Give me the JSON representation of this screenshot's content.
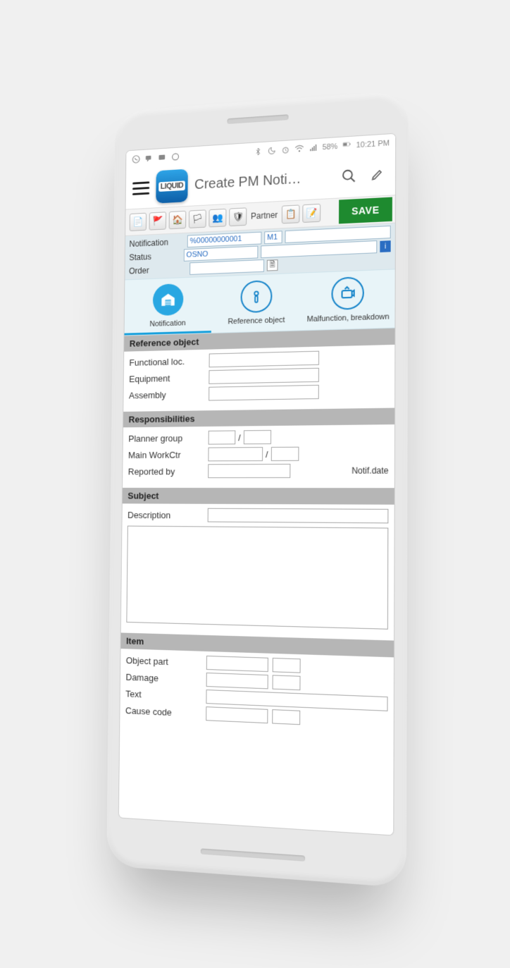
{
  "statusbar": {
    "battery": "58%",
    "time": "10:21 PM"
  },
  "app": {
    "logo": "LIQUID",
    "title": "Create PM Noti…"
  },
  "sapbar": {
    "partner_label": "Partner",
    "save_label": "SAVE"
  },
  "header": {
    "notification_lbl": "Notification",
    "notification_val": "%00000000001",
    "notification_code": "M1",
    "status_lbl": "Status",
    "status_val": "OSNO",
    "order_lbl": "Order"
  },
  "tabs": {
    "notification": "Notification",
    "reference": "Reference object",
    "malfunction": "Malfunction, breakdown"
  },
  "sections": {
    "reference": {
      "title": "Reference object",
      "func_loc": "Functional loc.",
      "equipment": "Equipment",
      "assembly": "Assembly"
    },
    "responsibilities": {
      "title": "Responsibilities",
      "planner_group": "Planner group",
      "main_workctr": "Main WorkCtr",
      "reported_by": "Reported by",
      "notif_date": "Notif.date",
      "slash": "/"
    },
    "subject": {
      "title": "Subject",
      "description": "Description"
    },
    "item": {
      "title": "Item",
      "object_part": "Object part",
      "damage": "Damage",
      "text": "Text",
      "cause_code": "Cause code"
    }
  }
}
